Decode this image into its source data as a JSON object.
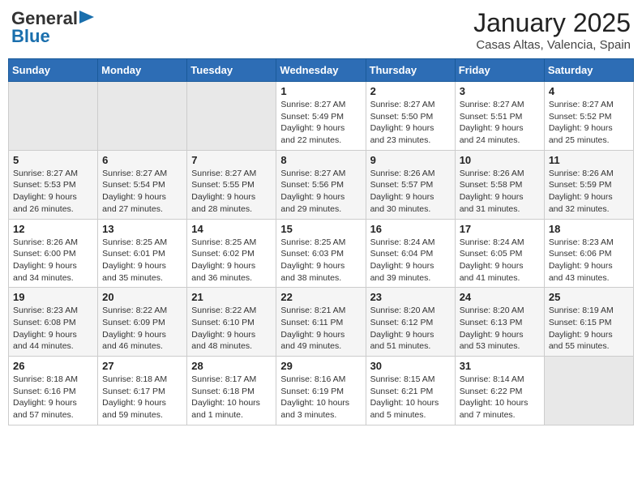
{
  "header": {
    "logo_line1": "General",
    "logo_line2": "Blue",
    "month": "January 2025",
    "location": "Casas Altas, Valencia, Spain"
  },
  "weekdays": [
    "Sunday",
    "Monday",
    "Tuesday",
    "Wednesday",
    "Thursday",
    "Friday",
    "Saturday"
  ],
  "weeks": [
    [
      {
        "day": "",
        "sunrise": "",
        "sunset": "",
        "daylight": ""
      },
      {
        "day": "",
        "sunrise": "",
        "sunset": "",
        "daylight": ""
      },
      {
        "day": "",
        "sunrise": "",
        "sunset": "",
        "daylight": ""
      },
      {
        "day": "1",
        "sunrise": "Sunrise: 8:27 AM",
        "sunset": "Sunset: 5:49 PM",
        "daylight": "Daylight: 9 hours and 22 minutes."
      },
      {
        "day": "2",
        "sunrise": "Sunrise: 8:27 AM",
        "sunset": "Sunset: 5:50 PM",
        "daylight": "Daylight: 9 hours and 23 minutes."
      },
      {
        "day": "3",
        "sunrise": "Sunrise: 8:27 AM",
        "sunset": "Sunset: 5:51 PM",
        "daylight": "Daylight: 9 hours and 24 minutes."
      },
      {
        "day": "4",
        "sunrise": "Sunrise: 8:27 AM",
        "sunset": "Sunset: 5:52 PM",
        "daylight": "Daylight: 9 hours and 25 minutes."
      }
    ],
    [
      {
        "day": "5",
        "sunrise": "Sunrise: 8:27 AM",
        "sunset": "Sunset: 5:53 PM",
        "daylight": "Daylight: 9 hours and 26 minutes."
      },
      {
        "day": "6",
        "sunrise": "Sunrise: 8:27 AM",
        "sunset": "Sunset: 5:54 PM",
        "daylight": "Daylight: 9 hours and 27 minutes."
      },
      {
        "day": "7",
        "sunrise": "Sunrise: 8:27 AM",
        "sunset": "Sunset: 5:55 PM",
        "daylight": "Daylight: 9 hours and 28 minutes."
      },
      {
        "day": "8",
        "sunrise": "Sunrise: 8:27 AM",
        "sunset": "Sunset: 5:56 PM",
        "daylight": "Daylight: 9 hours and 29 minutes."
      },
      {
        "day": "9",
        "sunrise": "Sunrise: 8:26 AM",
        "sunset": "Sunset: 5:57 PM",
        "daylight": "Daylight: 9 hours and 30 minutes."
      },
      {
        "day": "10",
        "sunrise": "Sunrise: 8:26 AM",
        "sunset": "Sunset: 5:58 PM",
        "daylight": "Daylight: 9 hours and 31 minutes."
      },
      {
        "day": "11",
        "sunrise": "Sunrise: 8:26 AM",
        "sunset": "Sunset: 5:59 PM",
        "daylight": "Daylight: 9 hours and 32 minutes."
      }
    ],
    [
      {
        "day": "12",
        "sunrise": "Sunrise: 8:26 AM",
        "sunset": "Sunset: 6:00 PM",
        "daylight": "Daylight: 9 hours and 34 minutes."
      },
      {
        "day": "13",
        "sunrise": "Sunrise: 8:25 AM",
        "sunset": "Sunset: 6:01 PM",
        "daylight": "Daylight: 9 hours and 35 minutes."
      },
      {
        "day": "14",
        "sunrise": "Sunrise: 8:25 AM",
        "sunset": "Sunset: 6:02 PM",
        "daylight": "Daylight: 9 hours and 36 minutes."
      },
      {
        "day": "15",
        "sunrise": "Sunrise: 8:25 AM",
        "sunset": "Sunset: 6:03 PM",
        "daylight": "Daylight: 9 hours and 38 minutes."
      },
      {
        "day": "16",
        "sunrise": "Sunrise: 8:24 AM",
        "sunset": "Sunset: 6:04 PM",
        "daylight": "Daylight: 9 hours and 39 minutes."
      },
      {
        "day": "17",
        "sunrise": "Sunrise: 8:24 AM",
        "sunset": "Sunset: 6:05 PM",
        "daylight": "Daylight: 9 hours and 41 minutes."
      },
      {
        "day": "18",
        "sunrise": "Sunrise: 8:23 AM",
        "sunset": "Sunset: 6:06 PM",
        "daylight": "Daylight: 9 hours and 43 minutes."
      }
    ],
    [
      {
        "day": "19",
        "sunrise": "Sunrise: 8:23 AM",
        "sunset": "Sunset: 6:08 PM",
        "daylight": "Daylight: 9 hours and 44 minutes."
      },
      {
        "day": "20",
        "sunrise": "Sunrise: 8:22 AM",
        "sunset": "Sunset: 6:09 PM",
        "daylight": "Daylight: 9 hours and 46 minutes."
      },
      {
        "day": "21",
        "sunrise": "Sunrise: 8:22 AM",
        "sunset": "Sunset: 6:10 PM",
        "daylight": "Daylight: 9 hours and 48 minutes."
      },
      {
        "day": "22",
        "sunrise": "Sunrise: 8:21 AM",
        "sunset": "Sunset: 6:11 PM",
        "daylight": "Daylight: 9 hours and 49 minutes."
      },
      {
        "day": "23",
        "sunrise": "Sunrise: 8:20 AM",
        "sunset": "Sunset: 6:12 PM",
        "daylight": "Daylight: 9 hours and 51 minutes."
      },
      {
        "day": "24",
        "sunrise": "Sunrise: 8:20 AM",
        "sunset": "Sunset: 6:13 PM",
        "daylight": "Daylight: 9 hours and 53 minutes."
      },
      {
        "day": "25",
        "sunrise": "Sunrise: 8:19 AM",
        "sunset": "Sunset: 6:15 PM",
        "daylight": "Daylight: 9 hours and 55 minutes."
      }
    ],
    [
      {
        "day": "26",
        "sunrise": "Sunrise: 8:18 AM",
        "sunset": "Sunset: 6:16 PM",
        "daylight": "Daylight: 9 hours and 57 minutes."
      },
      {
        "day": "27",
        "sunrise": "Sunrise: 8:18 AM",
        "sunset": "Sunset: 6:17 PM",
        "daylight": "Daylight: 9 hours and 59 minutes."
      },
      {
        "day": "28",
        "sunrise": "Sunrise: 8:17 AM",
        "sunset": "Sunset: 6:18 PM",
        "daylight": "Daylight: 10 hours and 1 minute."
      },
      {
        "day": "29",
        "sunrise": "Sunrise: 8:16 AM",
        "sunset": "Sunset: 6:19 PM",
        "daylight": "Daylight: 10 hours and 3 minutes."
      },
      {
        "day": "30",
        "sunrise": "Sunrise: 8:15 AM",
        "sunset": "Sunset: 6:21 PM",
        "daylight": "Daylight: 10 hours and 5 minutes."
      },
      {
        "day": "31",
        "sunrise": "Sunrise: 8:14 AM",
        "sunset": "Sunset: 6:22 PM",
        "daylight": "Daylight: 10 hours and 7 minutes."
      },
      {
        "day": "",
        "sunrise": "",
        "sunset": "",
        "daylight": ""
      }
    ]
  ]
}
